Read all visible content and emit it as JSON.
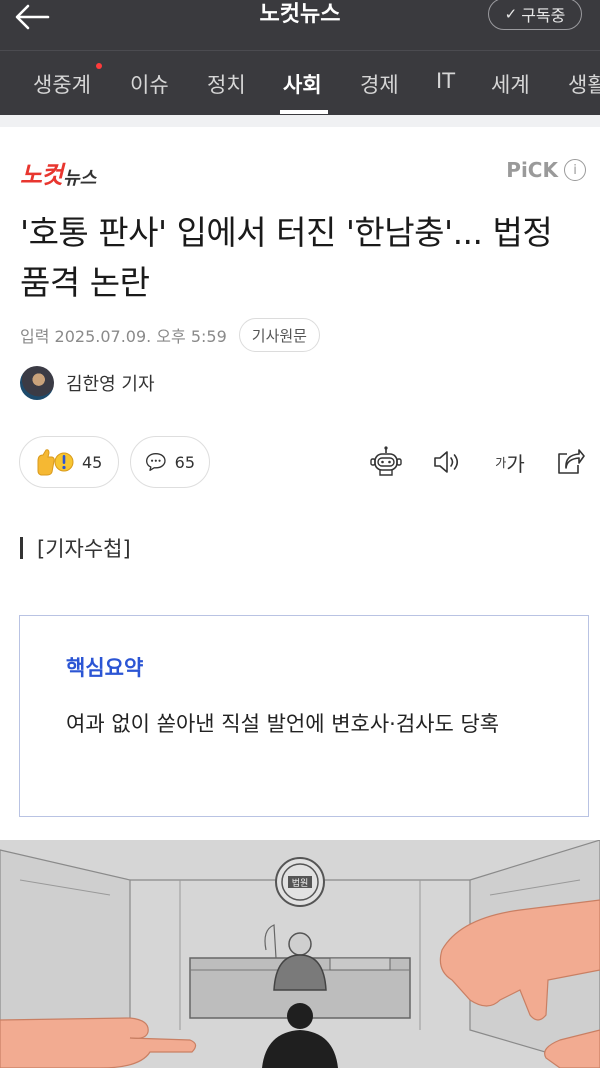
{
  "header": {
    "title": "노컷뉴스",
    "subscribe_label": "구독중",
    "subscribe_check": "✓"
  },
  "categories": [
    {
      "label": "생중계",
      "active": false
    },
    {
      "label": "이슈",
      "active": false
    },
    {
      "label": "정치",
      "active": false
    },
    {
      "label": "사회",
      "active": true
    },
    {
      "label": "경제",
      "active": false
    },
    {
      "label": "IT",
      "active": false
    },
    {
      "label": "세계",
      "active": false
    },
    {
      "label": "생활",
      "active": false
    }
  ],
  "article": {
    "press_logo_main": "노컷",
    "press_logo_sub": "뉴스",
    "pick_label": "PiCK",
    "pick_info": "i",
    "headline": "'호통 판사' 입에서 터진 '한남충'... 법정 품격 논란",
    "date": "입력 2025.07.09. 오후 5:59",
    "original_label": "기사원문",
    "reporter": "김한영 기자",
    "reaction_count": "45",
    "comment_count": "65",
    "font_size_small": "가",
    "font_size_large": "가",
    "section_tag": "[기자수첩]",
    "summary_title": "핵심요약",
    "summary_body": "여과 없이 쏟아낸 직설 발언에 변호사·검사도 당혹",
    "illustration_seal": "법원"
  },
  "colors": {
    "header_bg": "#3a3a3e",
    "brand_red": "#e8362f",
    "summary_accent": "#2b55d4",
    "summary_border": "#b9c3e3",
    "notification_dot": "#ff3b3b"
  }
}
